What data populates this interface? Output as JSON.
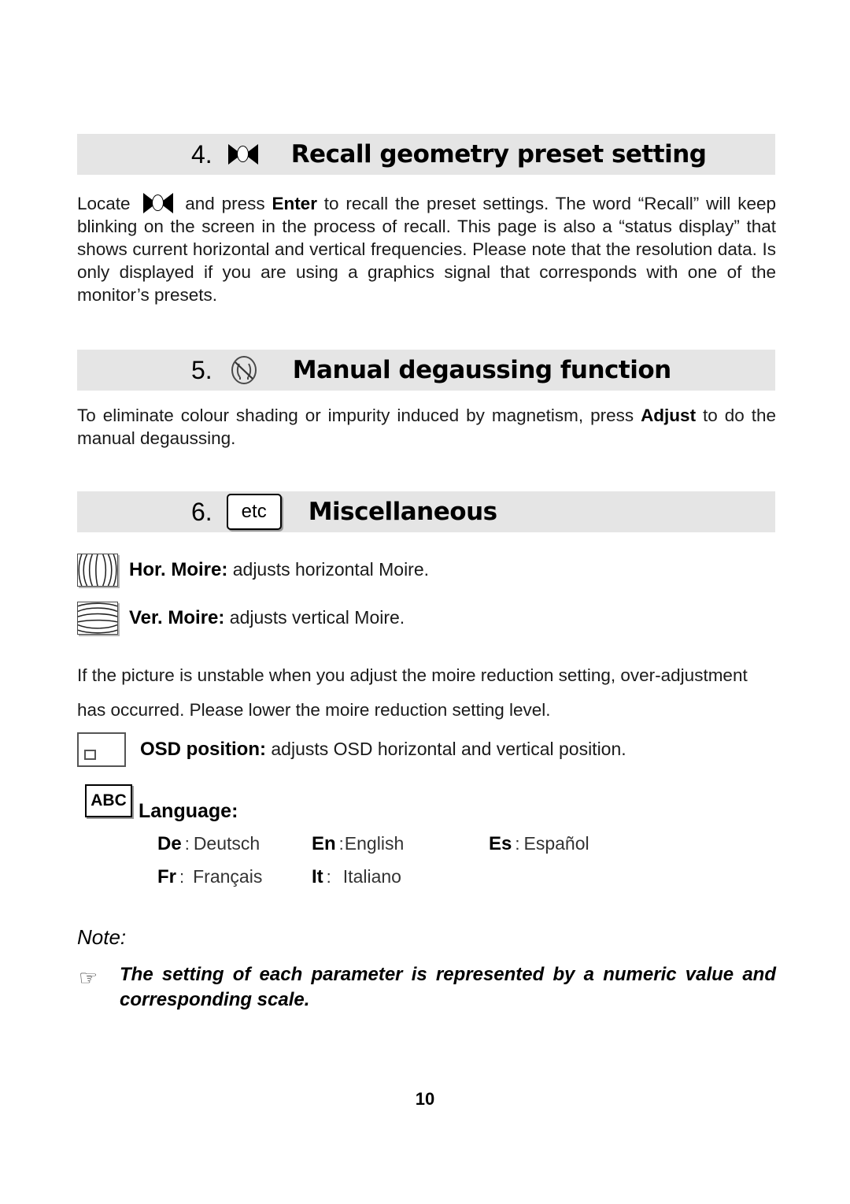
{
  "document": {
    "page_number": "10"
  },
  "sections": [
    {
      "number": "4.",
      "icon": "recall-bowtie-icon",
      "title": "Recall geometry preset setting",
      "body_parts": [
        {
          "t": "Locate ",
          "bold": false
        },
        {
          "t": "[recall-icon]",
          "bold": false
        },
        {
          "t": " and press ",
          "bold": false
        },
        {
          "t": "Enter",
          "bold": true
        },
        {
          "t": " to recall the preset settings.  The word “Recall” will keep blinking on the screen in the process of recall.  This page is also a “status display” that shows current horizontal and vertical frequencies.  Please note that the resolution data. Is only displayed if you are using a graphics signal that corresponds with one of the monitor’s presets.",
          "bold": false
        }
      ]
    },
    {
      "number": "5.",
      "icon": "degauss-icon",
      "title": "Manual degaussing function",
      "body_parts": [
        {
          "t": "To eliminate colour shading or impurity induced by magnetism, press ",
          "bold": false
        },
        {
          "t": "Adjust",
          "bold": true
        },
        {
          "t": " to do the manual degaussing.",
          "bold": false
        }
      ]
    },
    {
      "number": "6.",
      "icon": "etc-icon",
      "icon_label": "etc",
      "title": "Miscellaneous"
    }
  ],
  "section4": {
    "locate_prefix": "Locate",
    "after_icon": "and press",
    "enter_key": "Enter",
    "rest": "to recall the preset settings.  The word “Recall” will keep blinking on the screen in the process of recall.  This page is also a “status display” that shows current horizontal and vertical frequencies.  Please note that the resolution data. Is only displayed if you are using a graphics signal that corresponds with one of the monitor’s presets."
  },
  "section5": {
    "intro": "To eliminate colour shading or impurity induced by magnetism, press",
    "adjust_key": "Adjust",
    "rest": "to do the manual degaussing."
  },
  "section6": {
    "features": [
      {
        "icon": "hor-moire-icon",
        "label": "Hor. Moire:",
        "description": "adjusts horizontal Moire."
      },
      {
        "icon": "ver-moire-icon",
        "label": "Ver. Moire:",
        "description": "adjusts vertical Moire."
      }
    ],
    "moire_warning": "If the picture is unstable when you adjust the moire reduction setting, over-adjustment has occurred.  Please lower the moire reduction setting level.",
    "osd": {
      "icon": "osd-position-icon",
      "label": "OSD position:",
      "description": "adjusts OSD horizontal and vertical position."
    },
    "language": {
      "icon": "abc-icon",
      "icon_label": "ABC",
      "heading": "Language:",
      "separator": ":",
      "rows": [
        [
          {
            "code": "De",
            "name": "Deutsch"
          },
          {
            "code": "En",
            "name": "English"
          },
          {
            "code": "Es",
            "name": "Español"
          }
        ],
        [
          {
            "code": "Fr",
            "name": "Français"
          },
          {
            "code": "It",
            "name": "Italiano"
          }
        ]
      ]
    }
  },
  "note": {
    "label": "Note:",
    "bullet_icon": "pointing-hand-icon",
    "bullet_glyph": "☞",
    "text": "The setting of each parameter is represented by a numeric value and corresponding scale."
  }
}
